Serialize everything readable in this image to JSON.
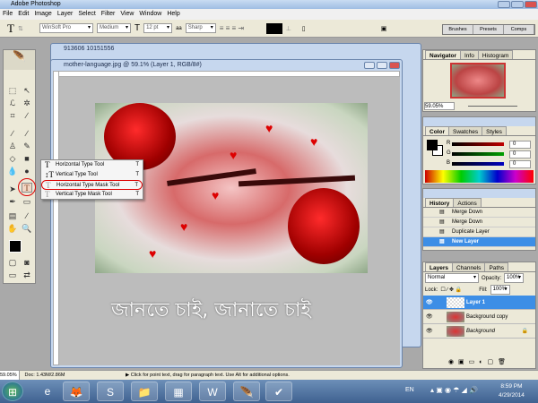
{
  "app": {
    "title": "Adobe Photoshop"
  },
  "menu": [
    "File",
    "Edit",
    "Image",
    "Layer",
    "Select",
    "Filter",
    "View",
    "Window",
    "Help"
  ],
  "options": {
    "tool_glyph": "T",
    "font_family": "WinSoft Pro",
    "font_style": "Medium",
    "font_size": "12 pt",
    "aa_label": "aa",
    "antialias": "Sharp",
    "color": "#000000",
    "panel_tabs": [
      "Brushes",
      "Presets",
      "Comps"
    ]
  },
  "documents": {
    "back_title": "913606 10151556",
    "front_title": "mother-language.jpg @ 59.1% (Layer 1, RGB/8#)",
    "image_text": "জানতে চাই, জানাতে চাই"
  },
  "flyout": {
    "items": [
      {
        "label": "Horizontal Type Tool",
        "key": "T",
        "glyph": "T"
      },
      {
        "label": "Vertical Type Tool",
        "key": "T",
        "glyph": "↕T"
      },
      {
        "label": "Horizontal Type Mask Tool",
        "key": "T",
        "glyph": "T"
      },
      {
        "label": "Vertical Type Mask Tool",
        "key": "T",
        "glyph": "T"
      }
    ],
    "highlighted": "Horizontal Type Mask Tool"
  },
  "navigator": {
    "tabs": [
      "Navigator",
      "Info",
      "Histogram"
    ],
    "zoom": "59.05%"
  },
  "color": {
    "tabs": [
      "Color",
      "Swatches",
      "Styles"
    ],
    "channels": [
      {
        "label": "R",
        "value": "0",
        "color": "#c00000"
      },
      {
        "label": "G",
        "value": "0",
        "color": "#00a000"
      },
      {
        "label": "B",
        "value": "0",
        "color": "#0000c0"
      }
    ]
  },
  "history": {
    "tabs": [
      "History",
      "Actions"
    ],
    "items": [
      "Merge Down",
      "Merge Down",
      "Duplicate Layer",
      "New Layer"
    ],
    "active": "New Layer"
  },
  "layers": {
    "tabs": [
      "Layers",
      "Channels",
      "Paths"
    ],
    "blend_mode": "Normal",
    "opacity_label": "Opacity:",
    "opacity": "100%",
    "lock_label": "Lock:",
    "fill_label": "Fill:",
    "fill": "100%",
    "items": [
      {
        "name": "Layer 1",
        "active": true
      },
      {
        "name": "Background copy"
      },
      {
        "name": "Background",
        "locked": true
      }
    ]
  },
  "status": {
    "zoom": "59.05%",
    "doc": "Doc: 1.43M/2.86M",
    "hint": "Click for point text, drag for paragraph text. Use Alt for additional options."
  },
  "taskbar": {
    "lang": "EN",
    "time": "8:59 PM",
    "date": "4/29/2014"
  }
}
